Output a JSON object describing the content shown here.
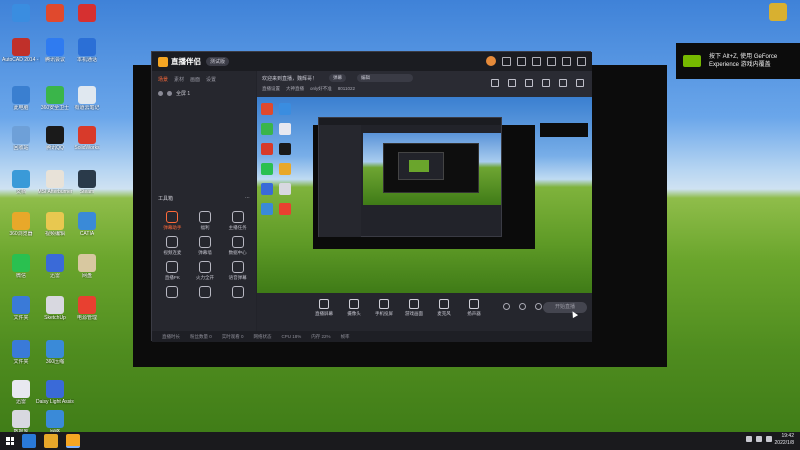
{
  "colors": {
    "accent": "#ff6a3a",
    "nvidia_green": "#76b900"
  },
  "desktop_icons": [
    {
      "label": "",
      "color": "#3a8de0"
    },
    {
      "label": "",
      "color": "#e0492d"
    },
    {
      "label": "",
      "color": "#d63030"
    },
    {
      "label": "AutoCAD 2014 - 简体中文",
      "color": "#c0302a"
    },
    {
      "label": "腾讯会议",
      "color": "#2f7bf0"
    },
    {
      "label": "本机通话",
      "color": "#2b6fd6"
    },
    {
      "label": "此电脑",
      "color": "#3a7fd0"
    },
    {
      "label": "360安全卫士",
      "color": "#3ab54a"
    },
    {
      "label": "有道云笔记",
      "color": "#e0e8f0"
    },
    {
      "label": "回收站",
      "color": "#6ea0d8"
    },
    {
      "label": "腾讯QQ",
      "color": "#1a1a1a"
    },
    {
      "label": "SolidWorks",
      "color": "#d83a2a"
    },
    {
      "label": "文档",
      "color": "#3a9ad8"
    },
    {
      "label": "MSI Afterburner",
      "color": "#e8e2d8"
    },
    {
      "label": "Steam",
      "color": "#2a3a4a"
    },
    {
      "label": "360浏览器",
      "color": "#e8a82a"
    },
    {
      "label": "视频编辑",
      "color": "#e8c850"
    },
    {
      "label": "CATIA",
      "color": "#3a8ad8"
    },
    {
      "label": "微信",
      "color": "#2ac050"
    },
    {
      "label": "迅雷",
      "color": "#3a6ad8"
    },
    {
      "label": "网盘",
      "color": "#d8c8a0"
    },
    {
      "label": "文件夹",
      "color": "#3a7ad8"
    },
    {
      "label": "SketchUp",
      "color": "#d8d8e0"
    },
    {
      "label": "电源管理",
      "color": "#e84030"
    },
    {
      "label": "文件夹",
      "color": "#3a7ad8"
    },
    {
      "label": "360压缩",
      "color": "#3a8ad8"
    },
    {
      "label": "迅雷",
      "color": "#e8e8f0"
    },
    {
      "label": "Daisy Light Assistant",
      "color": "#3a6ad8"
    },
    {
      "label": "数据库",
      "color": "#d8d8e0"
    },
    {
      "label": "网络",
      "color": "#3a8ad8"
    }
  ],
  "top_right_icon": {
    "label": "",
    "color": "#d8b030"
  },
  "app": {
    "title": "直播伴侣",
    "version": "测试版",
    "left_tabs": [
      "场景",
      "素材",
      "画面",
      "设置"
    ],
    "scene_label": "全屏 1",
    "tools_title": "工具箱",
    "tools": [
      {
        "label": "弹幕助手",
        "hot": true
      },
      {
        "label": "福利",
        "hot": false
      },
      {
        "label": "主播任务",
        "hot": false
      },
      {
        "label": "视频连麦",
        "hot": false
      },
      {
        "label": "弹幕墙",
        "hot": false
      },
      {
        "label": "数据中心",
        "hot": false
      },
      {
        "label": "直播PK",
        "hot": false
      },
      {
        "label": "火力全开",
        "hot": false
      },
      {
        "label": "语音弹幕",
        "hot": false
      },
      {
        "label": "",
        "hot": false
      },
      {
        "label": "",
        "hot": false
      },
      {
        "label": "",
        "hot": false
      }
    ],
    "welcome_text": "欢迎来到直播，魏辉哥！",
    "chip_a": "弹幕",
    "chip_b": "编辑",
    "subinfo": [
      "直播设置",
      "大神直播",
      "only好不准",
      "8011022"
    ],
    "bottom_buttons": [
      "直播屏幕",
      "摄像头",
      "手机投屏",
      "游戏画面",
      "麦克风",
      "扬声器"
    ],
    "live_button": "开始直播",
    "status_items": [
      "直播时长",
      "粉丝数量 0",
      "实时观看 0",
      "网络状态",
      "CPU 18%",
      "内存 22%",
      "帧率"
    ]
  },
  "toast": {
    "text": "按下 Alt+Z, 使用 GeForce Experience 游戏内覆盖"
  },
  "clock": {
    "time": "19:42",
    "date": "2022/1/8"
  }
}
